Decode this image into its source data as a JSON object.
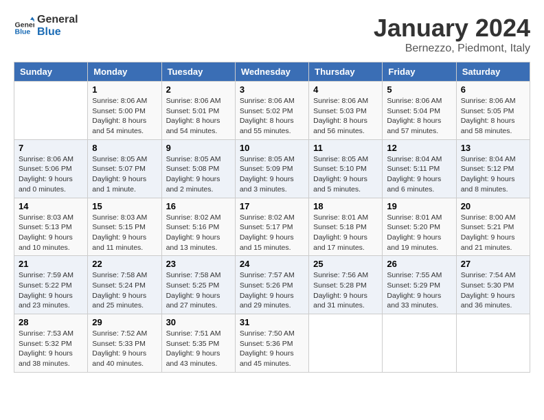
{
  "logo": {
    "line1": "General",
    "line2": "Blue"
  },
  "title": "January 2024",
  "subtitle": "Bernezzo, Piedmont, Italy",
  "columns": [
    "Sunday",
    "Monday",
    "Tuesday",
    "Wednesday",
    "Thursday",
    "Friday",
    "Saturday"
  ],
  "weeks": [
    [
      {
        "day": "",
        "sunrise": "",
        "sunset": "",
        "daylight": ""
      },
      {
        "day": "1",
        "sunrise": "Sunrise: 8:06 AM",
        "sunset": "Sunset: 5:00 PM",
        "daylight": "Daylight: 8 hours and 54 minutes."
      },
      {
        "day": "2",
        "sunrise": "Sunrise: 8:06 AM",
        "sunset": "Sunset: 5:01 PM",
        "daylight": "Daylight: 8 hours and 54 minutes."
      },
      {
        "day": "3",
        "sunrise": "Sunrise: 8:06 AM",
        "sunset": "Sunset: 5:02 PM",
        "daylight": "Daylight: 8 hours and 55 minutes."
      },
      {
        "day": "4",
        "sunrise": "Sunrise: 8:06 AM",
        "sunset": "Sunset: 5:03 PM",
        "daylight": "Daylight: 8 hours and 56 minutes."
      },
      {
        "day": "5",
        "sunrise": "Sunrise: 8:06 AM",
        "sunset": "Sunset: 5:04 PM",
        "daylight": "Daylight: 8 hours and 57 minutes."
      },
      {
        "day": "6",
        "sunrise": "Sunrise: 8:06 AM",
        "sunset": "Sunset: 5:05 PM",
        "daylight": "Daylight: 8 hours and 58 minutes."
      }
    ],
    [
      {
        "day": "7",
        "sunrise": "Sunrise: 8:06 AM",
        "sunset": "Sunset: 5:06 PM",
        "daylight": "Daylight: 9 hours and 0 minutes."
      },
      {
        "day": "8",
        "sunrise": "Sunrise: 8:05 AM",
        "sunset": "Sunset: 5:07 PM",
        "daylight": "Daylight: 9 hours and 1 minute."
      },
      {
        "day": "9",
        "sunrise": "Sunrise: 8:05 AM",
        "sunset": "Sunset: 5:08 PM",
        "daylight": "Daylight: 9 hours and 2 minutes."
      },
      {
        "day": "10",
        "sunrise": "Sunrise: 8:05 AM",
        "sunset": "Sunset: 5:09 PM",
        "daylight": "Daylight: 9 hours and 3 minutes."
      },
      {
        "day": "11",
        "sunrise": "Sunrise: 8:05 AM",
        "sunset": "Sunset: 5:10 PM",
        "daylight": "Daylight: 9 hours and 5 minutes."
      },
      {
        "day": "12",
        "sunrise": "Sunrise: 8:04 AM",
        "sunset": "Sunset: 5:11 PM",
        "daylight": "Daylight: 9 hours and 6 minutes."
      },
      {
        "day": "13",
        "sunrise": "Sunrise: 8:04 AM",
        "sunset": "Sunset: 5:12 PM",
        "daylight": "Daylight: 9 hours and 8 minutes."
      }
    ],
    [
      {
        "day": "14",
        "sunrise": "Sunrise: 8:03 AM",
        "sunset": "Sunset: 5:13 PM",
        "daylight": "Daylight: 9 hours and 10 minutes."
      },
      {
        "day": "15",
        "sunrise": "Sunrise: 8:03 AM",
        "sunset": "Sunset: 5:15 PM",
        "daylight": "Daylight: 9 hours and 11 minutes."
      },
      {
        "day": "16",
        "sunrise": "Sunrise: 8:02 AM",
        "sunset": "Sunset: 5:16 PM",
        "daylight": "Daylight: 9 hours and 13 minutes."
      },
      {
        "day": "17",
        "sunrise": "Sunrise: 8:02 AM",
        "sunset": "Sunset: 5:17 PM",
        "daylight": "Daylight: 9 hours and 15 minutes."
      },
      {
        "day": "18",
        "sunrise": "Sunrise: 8:01 AM",
        "sunset": "Sunset: 5:18 PM",
        "daylight": "Daylight: 9 hours and 17 minutes."
      },
      {
        "day": "19",
        "sunrise": "Sunrise: 8:01 AM",
        "sunset": "Sunset: 5:20 PM",
        "daylight": "Daylight: 9 hours and 19 minutes."
      },
      {
        "day": "20",
        "sunrise": "Sunrise: 8:00 AM",
        "sunset": "Sunset: 5:21 PM",
        "daylight": "Daylight: 9 hours and 21 minutes."
      }
    ],
    [
      {
        "day": "21",
        "sunrise": "Sunrise: 7:59 AM",
        "sunset": "Sunset: 5:22 PM",
        "daylight": "Daylight: 9 hours and 23 minutes."
      },
      {
        "day": "22",
        "sunrise": "Sunrise: 7:58 AM",
        "sunset": "Sunset: 5:24 PM",
        "daylight": "Daylight: 9 hours and 25 minutes."
      },
      {
        "day": "23",
        "sunrise": "Sunrise: 7:58 AM",
        "sunset": "Sunset: 5:25 PM",
        "daylight": "Daylight: 9 hours and 27 minutes."
      },
      {
        "day": "24",
        "sunrise": "Sunrise: 7:57 AM",
        "sunset": "Sunset: 5:26 PM",
        "daylight": "Daylight: 9 hours and 29 minutes."
      },
      {
        "day": "25",
        "sunrise": "Sunrise: 7:56 AM",
        "sunset": "Sunset: 5:28 PM",
        "daylight": "Daylight: 9 hours and 31 minutes."
      },
      {
        "day": "26",
        "sunrise": "Sunrise: 7:55 AM",
        "sunset": "Sunset: 5:29 PM",
        "daylight": "Daylight: 9 hours and 33 minutes."
      },
      {
        "day": "27",
        "sunrise": "Sunrise: 7:54 AM",
        "sunset": "Sunset: 5:30 PM",
        "daylight": "Daylight: 9 hours and 36 minutes."
      }
    ],
    [
      {
        "day": "28",
        "sunrise": "Sunrise: 7:53 AM",
        "sunset": "Sunset: 5:32 PM",
        "daylight": "Daylight: 9 hours and 38 minutes."
      },
      {
        "day": "29",
        "sunrise": "Sunrise: 7:52 AM",
        "sunset": "Sunset: 5:33 PM",
        "daylight": "Daylight: 9 hours and 40 minutes."
      },
      {
        "day": "30",
        "sunrise": "Sunrise: 7:51 AM",
        "sunset": "Sunset: 5:35 PM",
        "daylight": "Daylight: 9 hours and 43 minutes."
      },
      {
        "day": "31",
        "sunrise": "Sunrise: 7:50 AM",
        "sunset": "Sunset: 5:36 PM",
        "daylight": "Daylight: 9 hours and 45 minutes."
      },
      {
        "day": "",
        "sunrise": "",
        "sunset": "",
        "daylight": ""
      },
      {
        "day": "",
        "sunrise": "",
        "sunset": "",
        "daylight": ""
      },
      {
        "day": "",
        "sunrise": "",
        "sunset": "",
        "daylight": ""
      }
    ]
  ]
}
